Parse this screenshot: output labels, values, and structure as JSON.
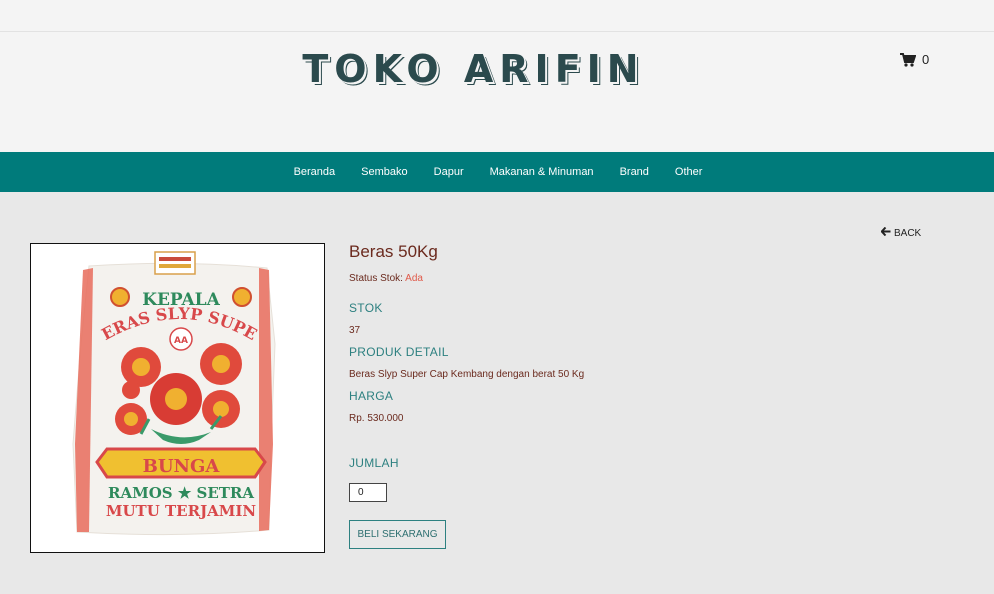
{
  "site": {
    "logo_text": "TOKO ARIFIN",
    "cart_count": "0"
  },
  "nav": {
    "items": [
      "Beranda",
      "Sembako",
      "Dapur",
      "Makanan & Minuman",
      "Brand",
      "Other"
    ]
  },
  "back": {
    "label": "BACK"
  },
  "product": {
    "title": "Beras 50Kg",
    "status_label": "Status Stok:",
    "status_value": "Ada",
    "stock_label": "STOK",
    "stock_value": "37",
    "detail_label": "PRODUK DETAIL",
    "detail_value": "Beras Slyp Super Cap Kembang dengan berat 50 Kg",
    "price_label": "HARGA",
    "price_value": "Rp. 530.000",
    "qty_label": "JUMLAH",
    "qty_value": "0",
    "buy_label": "BELI SEKARANG"
  },
  "package_image": {
    "line1": "KEPALA",
    "line2": "BERAS SLYP SUPER",
    "badge": "AA",
    "line3": "BUNGA",
    "line4": "RAMOS ★ SETRA",
    "line5": "MUTU TERJAMIN"
  },
  "colors": {
    "nav_bg": "#007b7b",
    "logo": "#2b4a4d",
    "label_teal": "#2d8080",
    "text_brown": "#6b2a1e",
    "status_ok": "#e05a4a"
  }
}
